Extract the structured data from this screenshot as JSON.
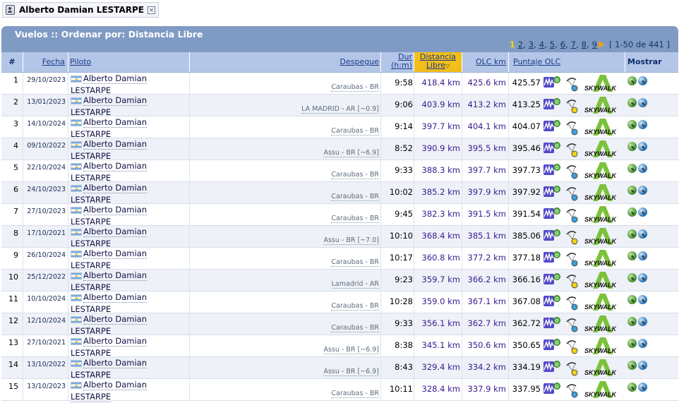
{
  "filter_chip": {
    "pilot_name": "Alberto Damian LESTARPE",
    "remove_symbol": "×"
  },
  "panel": {
    "title": "Vuelos :: Ordenar por: Distancia Libre"
  },
  "pager": {
    "current": "1",
    "pages": [
      "2",
      "3",
      "4",
      "5",
      "6",
      "7",
      "8",
      "9"
    ],
    "range": "[ 1-50 de 441 ]"
  },
  "columns": {
    "num": "#",
    "date": "Fecha",
    "pilot": "Piloto",
    "takeoff": "Despegue",
    "dur_line1": "Dur",
    "dur_line2": "(h:m)",
    "dist_line1": "Distancia",
    "dist_line2": "Libre",
    "olc_km": "OLC km",
    "olc_score": "Puntaje OLC",
    "show": "Mostrar"
  },
  "colors": {
    "header_band": "#7f9bc4",
    "header_row": "#b4c6e7",
    "sorted_col": "#f2be1b",
    "distance_text": "#3a1a8f"
  },
  "icons": [
    "pilot-icon",
    "remove-filter-icon",
    "next-page-arrow-icon",
    "argentina-flag-icon",
    "olc-graph-icon",
    "glider-icon",
    "skywalk-logo",
    "map-show-icon",
    "globe-show-icon"
  ],
  "rows": [
    {
      "num": "1",
      "date": "29/10/2023",
      "pilot": "Alberto Damian LESTARPE",
      "takeoff": "Caraubas - BR",
      "dur": "9:58",
      "dist": "418.4 km",
      "olc_km": "425.6 km",
      "score": "425.57",
      "glider_dot": "blue"
    },
    {
      "num": "2",
      "date": "13/01/2023",
      "pilot": "Alberto Damian LESTARPE",
      "takeoff": "LA MADRID - AR [~0.9]",
      "dur": "9:06",
      "dist": "403.9 km",
      "olc_km": "413.2 km",
      "score": "413.25",
      "glider_dot": "yellow"
    },
    {
      "num": "3",
      "date": "14/10/2024",
      "pilot": "Alberto Damian LESTARPE",
      "takeoff": "Caraubas - BR",
      "dur": "9:14",
      "dist": "397.7 km",
      "olc_km": "404.1 km",
      "score": "404.07",
      "glider_dot": "blue"
    },
    {
      "num": "4",
      "date": "09/10/2022",
      "pilot": "Alberto Damian LESTARPE",
      "takeoff": "Assu - BR [~6.9]",
      "dur": "8:52",
      "dist": "390.9 km",
      "olc_km": "395.5 km",
      "score": "395.46",
      "glider_dot": "yellow"
    },
    {
      "num": "5",
      "date": "22/10/2024",
      "pilot": "Alberto Damian LESTARPE",
      "takeoff": "Caraubas - BR",
      "dur": "9:33",
      "dist": "388.3 km",
      "olc_km": "397.7 km",
      "score": "397.73",
      "glider_dot": "blue"
    },
    {
      "num": "6",
      "date": "24/10/2023",
      "pilot": "Alberto Damian LESTARPE",
      "takeoff": "Caraubas - BR",
      "dur": "10:02",
      "dist": "385.2 km",
      "olc_km": "397.9 km",
      "score": "397.92",
      "glider_dot": "blue"
    },
    {
      "num": "7",
      "date": "27/10/2023",
      "pilot": "Alberto Damian LESTARPE",
      "takeoff": "Caraubas - BR",
      "dur": "9:45",
      "dist": "382.3 km",
      "olc_km": "391.5 km",
      "score": "391.54",
      "glider_dot": "blue"
    },
    {
      "num": "8",
      "date": "17/10/2021",
      "pilot": "Alberto Damian LESTARPE",
      "takeoff": "Assu - BR [~7.0]",
      "dur": "10:10",
      "dist": "368.4 km",
      "olc_km": "385.1 km",
      "score": "385.06",
      "glider_dot": "yellow"
    },
    {
      "num": "9",
      "date": "26/10/2024",
      "pilot": "Alberto Damian LESTARPE",
      "takeoff": "Caraubas - BR",
      "dur": "10:17",
      "dist": "360.8 km",
      "olc_km": "377.2 km",
      "score": "377.18",
      "glider_dot": "blue"
    },
    {
      "num": "10",
      "date": "25/12/2022",
      "pilot": "Alberto Damian LESTARPE",
      "takeoff": "Lamadrid - AR",
      "dur": "9:23",
      "dist": "359.7 km",
      "olc_km": "366.2 km",
      "score": "366.16",
      "glider_dot": "yellow"
    },
    {
      "num": "11",
      "date": "10/10/2024",
      "pilot": "Alberto Damian LESTARPE",
      "takeoff": "Caraubas - BR",
      "dur": "10:28",
      "dist": "359.0 km",
      "olc_km": "367.1 km",
      "score": "367.08",
      "glider_dot": "blue"
    },
    {
      "num": "12",
      "date": "12/10/2024",
      "pilot": "Alberto Damian LESTARPE",
      "takeoff": "Caraubas - BR",
      "dur": "9:33",
      "dist": "356.1 km",
      "olc_km": "362.7 km",
      "score": "362.72",
      "glider_dot": "blue"
    },
    {
      "num": "13",
      "date": "27/10/2021",
      "pilot": "Alberto Damian LESTARPE",
      "takeoff": "Assu - BR [~6.9]",
      "dur": "8:38",
      "dist": "345.1 km",
      "olc_km": "350.6 km",
      "score": "350.65",
      "glider_dot": "yellow"
    },
    {
      "num": "14",
      "date": "13/10/2022",
      "pilot": "Alberto Damian LESTARPE",
      "takeoff": "Assu - BR [~6.9]",
      "dur": "8:43",
      "dist": "329.4 km",
      "olc_km": "334.2 km",
      "score": "334.19",
      "glider_dot": "yellow"
    },
    {
      "num": "15",
      "date": "13/10/2023",
      "pilot": "Alberto Damian LESTARPE",
      "takeoff": "Caraubas - BR",
      "dur": "10:11",
      "dist": "328.4 km",
      "olc_km": "337.9 km",
      "score": "337.95",
      "glider_dot": "blue"
    }
  ]
}
